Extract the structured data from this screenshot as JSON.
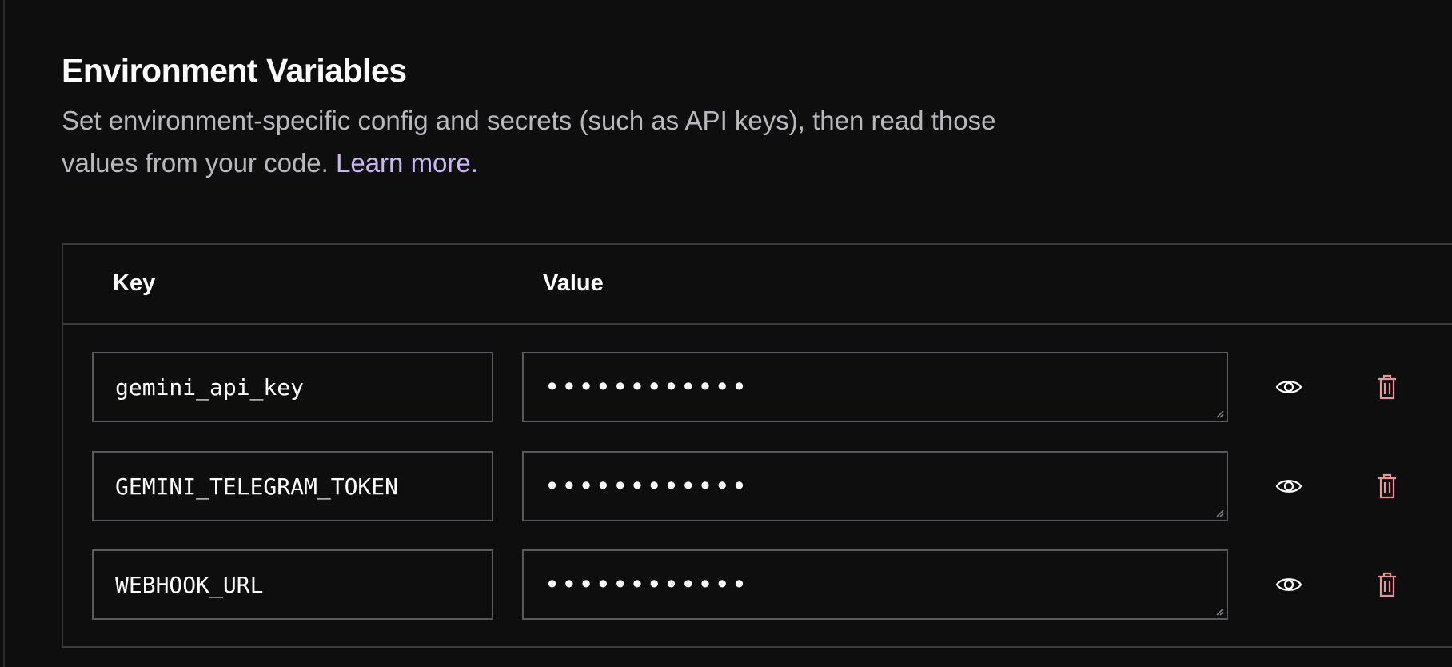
{
  "header": {
    "title": "Environment Variables",
    "description": "Set environment-specific config and secrets (such as API keys), then read those values from your code.",
    "learn_more": "Learn more."
  },
  "table": {
    "columns": {
      "key": "Key",
      "value": "Value"
    },
    "rows": [
      {
        "key": "gemini_api_key",
        "value_masked": "••••••••••••"
      },
      {
        "key": "GEMINI_TELEGRAM_TOKEN",
        "value_masked": "••••••••••••"
      },
      {
        "key": "WEBHOOK_URL",
        "value_masked": "••••••••••••"
      }
    ]
  },
  "icons": {
    "reveal": "eye-icon",
    "delete": "trash-icon"
  },
  "colors": {
    "background": "#0e0e0f",
    "link": "#c8b6f5",
    "delete_icon": "#e8949a",
    "border": "#5a5a5e"
  }
}
